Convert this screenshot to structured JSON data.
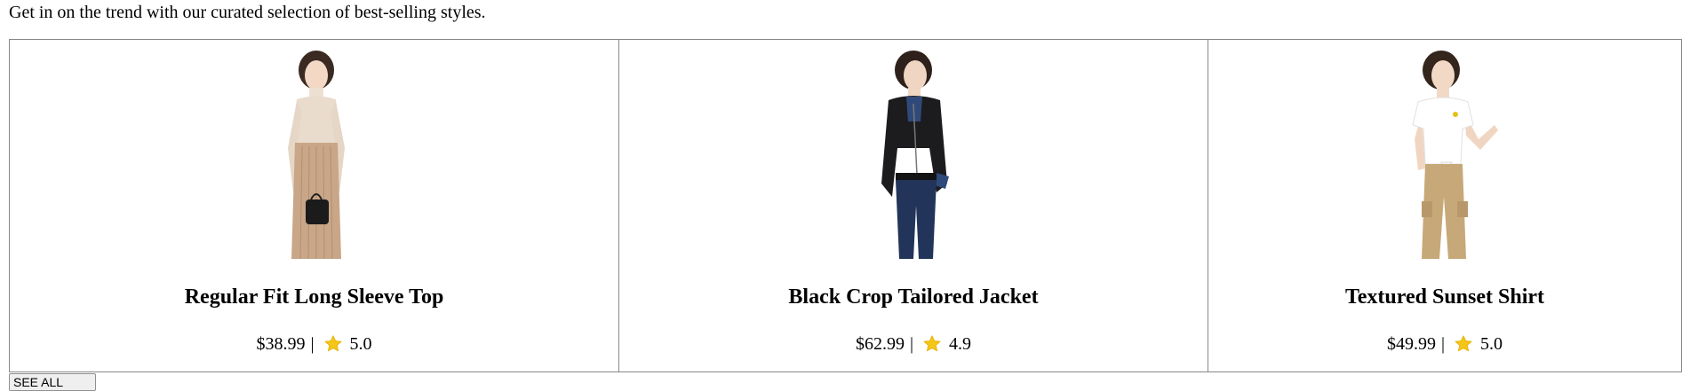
{
  "intro": "Get in on the trend with our curated selection of best-selling styles.",
  "products": [
    {
      "title": "Regular Fit Long Sleeve Top",
      "price": "$38.99",
      "separator": "|",
      "rating": "5.0",
      "image_icon": "model-beige-top-photo"
    },
    {
      "title": "Black Crop Tailored Jacket",
      "price": "$62.99",
      "separator": "|",
      "rating": "4.9",
      "image_icon": "model-black-jacket-photo"
    },
    {
      "title": "Textured Sunset Shirt",
      "price": "$49.99",
      "separator": "|",
      "rating": "5.0",
      "image_icon": "model-white-shirt-photo"
    }
  ],
  "see_all_button": "SEE ALL",
  "colors": {
    "star": "#f5c518",
    "border": "#888888"
  }
}
